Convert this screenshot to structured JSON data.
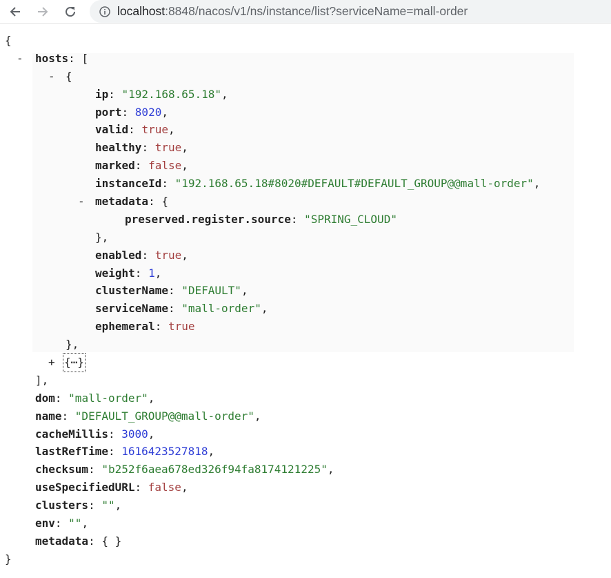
{
  "browser": {
    "url_host": "localhost",
    "url_rest": ":8848/nacos/v1/ns/instance/list?serviceName=mall-order",
    "back_icon": "arrow-left-icon",
    "forward_icon": "arrow-right-icon",
    "reload_icon": "reload-icon",
    "info_icon": "info-icon"
  },
  "json": {
    "open_brace": "{",
    "close_brace": "}",
    "hosts_key": "hosts",
    "hosts": [
      {
        "ip": "\"192.168.65.18\"",
        "port": "8020",
        "valid": "true",
        "healthy": "true",
        "marked": "false",
        "instanceId": "\"192.168.65.18#8020#DEFAULT#DEFAULT_GROUP@@mall-order\"",
        "metadata_key": "metadata",
        "metadata_entry_key": "preserved.register.source",
        "metadata_entry_value": "\"SPRING_CLOUD\"",
        "enabled": "true",
        "weight": "1",
        "clusterName": "\"DEFAULT\"",
        "serviceName": "\"mall-order\"",
        "ephemeral": "true"
      }
    ],
    "collapsed_item": "{⋯}",
    "dom": "\"mall-order\"",
    "name": "\"DEFAULT_GROUP@@mall-order\"",
    "cacheMillis": "3000",
    "lastRefTime": "1616423527818",
    "checksum": "\"b252f6aea678ed326f94fa8174121225\"",
    "useSpecifiedURL": "false",
    "clusters": "\"\"",
    "env": "\"\"",
    "metadata": "{ }"
  },
  "colors": {
    "key": "#222222",
    "string": "#2e7d32",
    "number": "#2f3ed6",
    "boolean": "#a34040"
  }
}
